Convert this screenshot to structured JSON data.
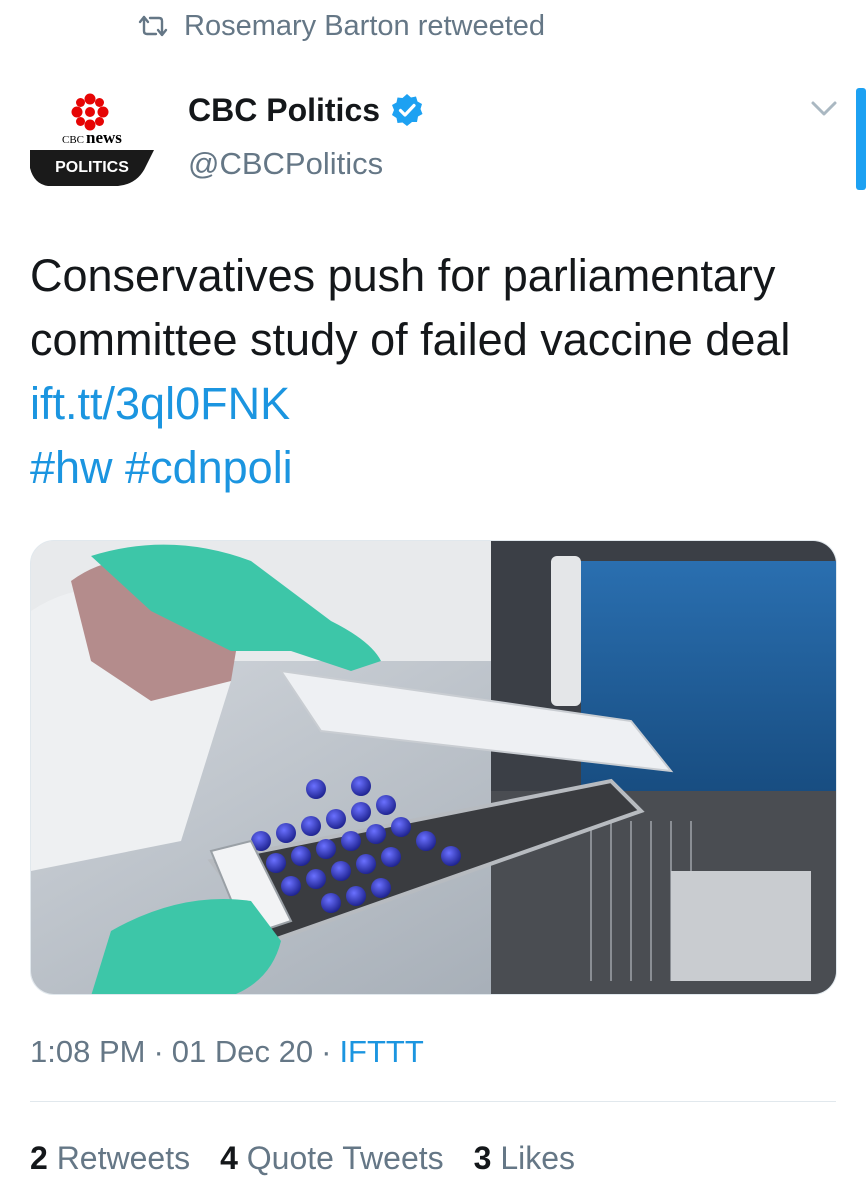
{
  "retweet_context": {
    "icon": "retweet-icon",
    "text": "Rosemary Barton retweeted"
  },
  "author": {
    "display_name": "CBC Politics",
    "handle": "@CBCPolitics",
    "verified": true,
    "avatar": {
      "brand_top": "CBC",
      "brand_bottom": "news",
      "label": "POLITICS",
      "accent": "#e60505"
    }
  },
  "tweet": {
    "text": "Conservatives push for parliamentary committee study of failed vaccine deal ",
    "link": "ift.tt/3ql0FNK",
    "hashtags": "#hw #cdnpoli"
  },
  "media": {
    "description_icon": "vaccine-lab-photo"
  },
  "meta": {
    "time": "1:08 PM",
    "date": "01 Dec 20",
    "source": "IFTTT",
    "separator": "·"
  },
  "stats": {
    "retweets": {
      "count": "2",
      "label": "Retweets"
    },
    "quote_tweets": {
      "count": "4",
      "label": "Quote Tweets"
    },
    "likes": {
      "count": "3",
      "label": "Likes"
    }
  },
  "colors": {
    "link": "#1b95e0",
    "secondary_text": "#657786",
    "verified": "#1da1f2"
  }
}
